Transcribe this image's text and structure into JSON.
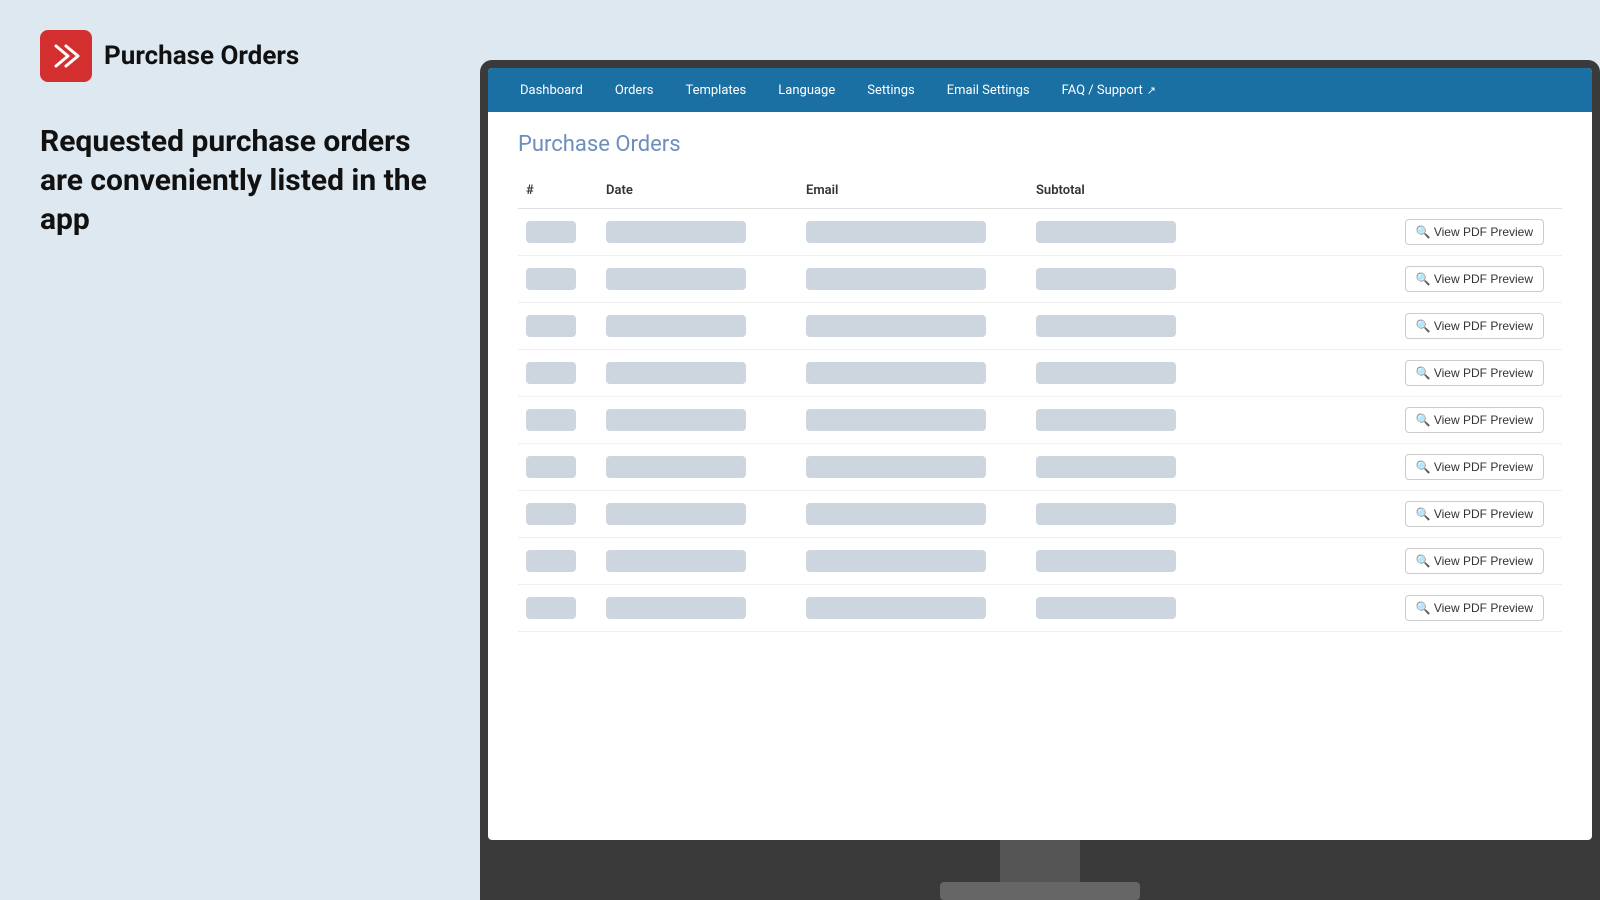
{
  "app": {
    "logo_text": "Purchase Orders",
    "tagline": "Requested purchase orders are conveniently listed in the app"
  },
  "nav": {
    "items": [
      {
        "id": "dashboard",
        "label": "Dashboard",
        "active": false
      },
      {
        "id": "orders",
        "label": "Orders",
        "active": false
      },
      {
        "id": "templates",
        "label": "Templates",
        "active": false
      },
      {
        "id": "language",
        "label": "Language",
        "active": false
      },
      {
        "id": "settings",
        "label": "Settings",
        "active": false
      },
      {
        "id": "email-settings",
        "label": "Email Settings",
        "active": false
      },
      {
        "id": "faq-support",
        "label": "FAQ / Support",
        "active": false,
        "ext": "↗"
      }
    ]
  },
  "main": {
    "page_title": "Purchase Orders",
    "table": {
      "columns": [
        "#",
        "Date",
        "Email",
        "Subtotal",
        ""
      ],
      "rows": 9,
      "view_pdf_label": "View PDF Preview"
    }
  }
}
